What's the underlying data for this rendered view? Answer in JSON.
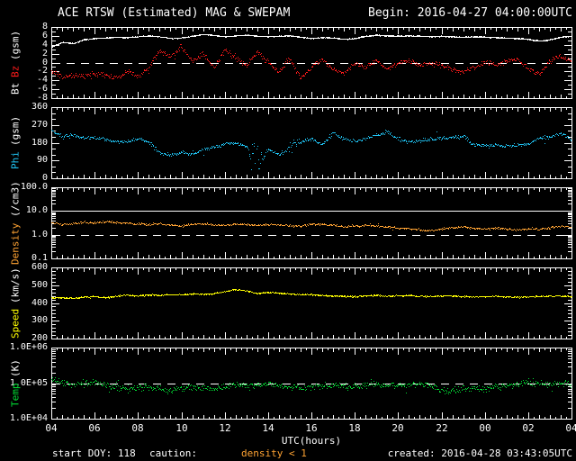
{
  "title": {
    "left": "ACE RTSW (Estimated) MAG & SWEPAM",
    "right": "Begin: 2016-04-27 04:00:00UTC"
  },
  "footer": {
    "start_doy": "start DOY: 118",
    "caution_label": "caution:",
    "caution_value": "density < 1",
    "created": "created: 2016-04-28 03:43:05UTC"
  },
  "x_axis": {
    "label": "UTC(hours)",
    "tick_hours": [
      4,
      6,
      8,
      10,
      12,
      14,
      16,
      18,
      20,
      22,
      24,
      26,
      28
    ],
    "tick_labels": [
      "04",
      "06",
      "08",
      "10",
      "12",
      "14",
      "16",
      "18",
      "20",
      "22",
      "00",
      "02",
      "04"
    ],
    "start_hour": 4,
    "end_hour": 28
  },
  "colors": {
    "background": "#000000",
    "frame": "#ffffff",
    "bt": "#ffffff",
    "bz": "#ff1a1a",
    "phi": "#1fc3f3",
    "density": "#ffa333",
    "speed": "#ffff00",
    "temp": "#00dd33"
  },
  "chart_x": [
    4,
    4.5,
    5,
    5.5,
    6,
    6.5,
    7,
    7.5,
    8,
    8.5,
    9,
    9.5,
    10,
    10.5,
    11,
    11.5,
    12,
    12.5,
    13,
    13.5,
    14,
    14.5,
    15,
    15.5,
    16,
    16.5,
    17,
    17.5,
    18,
    18.5,
    19,
    19.5,
    20,
    20.5,
    21,
    21.5,
    22,
    22.5,
    23,
    23.5,
    24,
    24.5,
    25,
    25.5,
    26,
    26.5,
    27,
    27.5,
    28
  ],
  "chart_data": [
    {
      "id": "mag",
      "type": "scatter",
      "ylabel_parts": [
        {
          "text": "Bt",
          "color": "#ffffff"
        },
        {
          "text": "Bz",
          "color": "#ff1a1a"
        },
        {
          "text": "(gsm)",
          "color": "#ffffff"
        }
      ],
      "ylim": [
        -8,
        8
      ],
      "ylog": false,
      "yminor": 1,
      "yticks": [
        {
          "v": 8,
          "label": "8"
        },
        {
          "v": 6,
          "label": "6"
        },
        {
          "v": 4,
          "label": "4"
        },
        {
          "v": 2,
          "label": "2"
        },
        {
          "v": 0,
          "label": "0"
        },
        {
          "v": -2,
          "label": "-2"
        },
        {
          "v": -4,
          "label": "-4"
        },
        {
          "v": -6,
          "label": "-6"
        },
        {
          "v": -8,
          "label": "-8"
        }
      ],
      "ref_lines": [
        {
          "v": 0,
          "style": "dashed"
        }
      ],
      "series": [
        {
          "name": "Bz",
          "color": "#ff1a1a",
          "values": [
            -2.0,
            -3.2,
            -2.6,
            -3.0,
            -2.4,
            -2.8,
            -3.4,
            -2.2,
            -3.0,
            -1.0,
            2.8,
            1.5,
            3.5,
            0.5,
            2.0,
            -1.0,
            3.0,
            1.0,
            -0.5,
            2.5,
            0.0,
            -2.0,
            1.0,
            -3.5,
            -1.0,
            1.0,
            -1.5,
            -2.5,
            0.0,
            -1.0,
            0.5,
            -1.5,
            0.0,
            0.5,
            -0.5,
            0.0,
            -0.5,
            -1.5,
            -2.0,
            -1.0,
            0.0,
            -0.3,
            0.5,
            0.8,
            -1.5,
            -2.5,
            0.5,
            1.5,
            0.5
          ],
          "scatter": {
            "step": 0.03,
            "jitter": 0.85,
            "out_p": 0.05,
            "out_mult": 1.8
          }
        },
        {
          "name": "Bt",
          "color": "#ffffff",
          "values": [
            3.6,
            4.6,
            4.4,
            5.2,
            5.5,
            5.6,
            5.8,
            5.7,
            5.9,
            6.1,
            5.9,
            5.5,
            5.6,
            6.0,
            6.4,
            6.2,
            5.9,
            6.1,
            6.3,
            6.0,
            5.9,
            6.0,
            6.1,
            5.8,
            5.5,
            5.7,
            5.6,
            5.3,
            5.5,
            6.0,
            6.2,
            6.1,
            6.0,
            6.1,
            6.0,
            5.9,
            6.0,
            5.9,
            5.8,
            5.9,
            5.8,
            5.7,
            5.6,
            5.5,
            5.3,
            4.9,
            5.2,
            5.8,
            6.0
          ],
          "scatter": {
            "step": 0.015,
            "jitter": 0.15,
            "out_p": 0.01,
            "out_mult": 2
          }
        }
      ]
    },
    {
      "id": "phi",
      "type": "scatter",
      "ylabel_parts": [
        {
          "text": "Phi",
          "color": "#1fc3f3"
        },
        {
          "text": "(gsm)",
          "color": "#ffffff"
        }
      ],
      "ylim": [
        0,
        360
      ],
      "ylog": false,
      "yminor": 30,
      "yticks": [
        {
          "v": 360,
          "label": "360"
        },
        {
          "v": 270,
          "label": "270"
        },
        {
          "v": 180,
          "label": "180"
        },
        {
          "v": 90,
          "label": "90"
        },
        {
          "v": 0,
          "label": "0"
        }
      ],
      "ref_lines": [],
      "series": [
        {
          "name": "Phi",
          "color": "#1fc3f3",
          "values": [
            240,
            215,
            220,
            205,
            210,
            195,
            185,
            190,
            200,
            185,
            130,
            115,
            135,
            120,
            150,
            160,
            175,
            180,
            165,
            60,
            150,
            120,
            160,
            185,
            200,
            170,
            230,
            200,
            190,
            205,
            220,
            235,
            200,
            185,
            195,
            200,
            205,
            210,
            215,
            170,
            165,
            170,
            165,
            170,
            175,
            205,
            210,
            230,
            195
          ],
          "scatter": {
            "step": 0.03,
            "jitter": 14,
            "out_p": 0.05,
            "out_mult": 3,
            "clamp": [
              2,
              358
            ],
            "zones": [
              {
                "t0": 13.1,
                "t1": 13.7,
                "jitter": 150
              },
              {
                "t0": 14.9,
                "t1": 15.4,
                "jitter": 55
              }
            ]
          }
        }
      ]
    },
    {
      "id": "density",
      "type": "scatter",
      "ylabel_parts": [
        {
          "text": "Density",
          "color": "#ffa333"
        },
        {
          "text": "(/cm3)",
          "color": "#ffffff"
        }
      ],
      "ylim": [
        0.1,
        100
      ],
      "ylog": true,
      "yticks": [
        {
          "v": 100,
          "label": "100.0"
        },
        {
          "v": 10,
          "label": "10.0"
        },
        {
          "v": 1,
          "label": "1.0"
        },
        {
          "v": 0.1,
          "label": "0.1"
        }
      ],
      "ref_lines": [
        {
          "v": 10,
          "style": "solid"
        },
        {
          "v": 1,
          "style": "dashed"
        }
      ],
      "series": [
        {
          "name": "Density",
          "color": "#ffa333",
          "values": [
            3.2,
            2.8,
            3.0,
            3.4,
            3.3,
            3.6,
            3.4,
            3.2,
            3.0,
            2.8,
            3.0,
            2.6,
            2.4,
            2.8,
            3.0,
            2.7,
            2.6,
            2.9,
            2.8,
            2.6,
            2.8,
            2.7,
            2.6,
            2.4,
            2.8,
            2.8,
            2.6,
            2.2,
            2.4,
            2.6,
            2.4,
            2.2,
            2.0,
            1.8,
            1.6,
            1.5,
            1.8,
            2.0,
            2.2,
            1.9,
            1.8,
            2.0,
            1.8,
            1.7,
            1.9,
            1.8,
            2.0,
            2.4,
            2.2
          ],
          "scatter": {
            "step": 0.03,
            "jitter": 0.13,
            "out_p": 0.06,
            "out_mult": 2.5,
            "extreme": 8
          }
        }
      ]
    },
    {
      "id": "speed",
      "type": "scatter",
      "ylabel_parts": [
        {
          "text": "Speed",
          "color": "#ffff00"
        },
        {
          "text": "(km/s)",
          "color": "#ffffff"
        }
      ],
      "ylim": [
        200,
        600
      ],
      "ylog": false,
      "yminor": 20,
      "yticks": [
        {
          "v": 600,
          "label": "600"
        },
        {
          "v": 500,
          "label": "500"
        },
        {
          "v": 400,
          "label": "400"
        },
        {
          "v": 300,
          "label": "300"
        },
        {
          "v": 200,
          "label": "200"
        }
      ],
      "ref_lines": [],
      "series": [
        {
          "name": "Speed",
          "color": "#ffff00",
          "values": [
            430,
            432,
            428,
            435,
            438,
            432,
            440,
            445,
            442,
            448,
            445,
            450,
            448,
            452,
            450,
            455,
            465,
            478,
            470,
            455,
            462,
            458,
            452,
            450,
            448,
            445,
            442,
            440,
            438,
            442,
            445,
            440,
            442,
            445,
            440,
            438,
            442,
            440,
            438,
            436,
            438,
            440,
            436,
            434,
            436,
            438,
            440,
            442,
            438
          ],
          "scatter": {
            "step": 0.025,
            "jitter": 6,
            "out_p": 0.03,
            "out_mult": 2
          }
        }
      ]
    },
    {
      "id": "temp",
      "type": "scatter",
      "ylabel_parts": [
        {
          "text": "Temp",
          "color": "#00dd33"
        },
        {
          "text": "(K)",
          "color": "#ffffff"
        }
      ],
      "ylim": [
        10000,
        1000000
      ],
      "ylog": true,
      "yticks": [
        {
          "v": 1000000,
          "label": "1.0E+06"
        },
        {
          "v": 100000,
          "label": "1.0E+05"
        },
        {
          "v": 10000,
          "label": "1.0E+04"
        }
      ],
      "ref_lines": [
        {
          "v": 100000,
          "style": "dashed"
        }
      ],
      "series": [
        {
          "name": "Temp",
          "color": "#00dd33",
          "values": [
            130000,
            110000,
            90000,
            100000,
            110000,
            90000,
            80000,
            70000,
            75000,
            80000,
            70000,
            65000,
            70000,
            80000,
            75000,
            70000,
            80000,
            90000,
            85000,
            90000,
            95000,
            85000,
            80000,
            75000,
            80000,
            85000,
            90000,
            85000,
            80000,
            90000,
            95000,
            90000,
            85000,
            90000,
            95000,
            90000,
            65000,
            60000,
            70000,
            75000,
            70000,
            80000,
            90000,
            100000,
            110000,
            100000,
            95000,
            105000,
            90000
          ],
          "scatter": {
            "step": 0.03,
            "jitter": 0.3,
            "out_p": 0.06,
            "out_mult": 2
          }
        }
      ]
    }
  ]
}
